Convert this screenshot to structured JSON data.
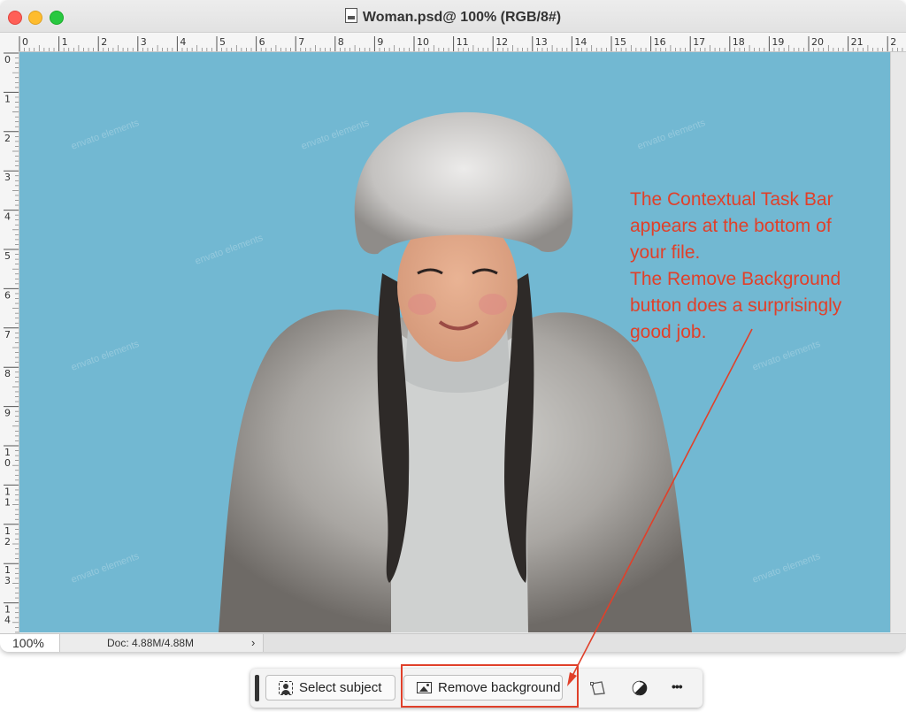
{
  "window": {
    "title": "Woman.psd@ 100% (RGB/8#)"
  },
  "ruler": {
    "horizontal": [
      "0",
      "1",
      "2",
      "3",
      "4",
      "5",
      "6",
      "7",
      "8",
      "9",
      "10",
      "11",
      "12",
      "13",
      "14",
      "15",
      "16",
      "17",
      "18",
      "19",
      "20",
      "21",
      "2"
    ],
    "vertical": [
      "0",
      "1",
      "2",
      "3",
      "4",
      "5",
      "6",
      "7",
      "8",
      "9",
      "1\n0",
      "1\n1",
      "1\n2",
      "1\n3",
      "1\n4"
    ]
  },
  "status": {
    "zoom": "100%",
    "doc": "Doc: 4.88M/4.88M",
    "arrow": "›"
  },
  "annotation": {
    "lines": [
      "The Contextual Task Bar",
      "appears at the bottom of",
      "your file.",
      "The Remove Background",
      "button does a surprisingly",
      "good job."
    ],
    "color": "#e0402a"
  },
  "taskbar": {
    "select_subject": "Select subject",
    "remove_background": "Remove background",
    "more": "•••"
  },
  "canvas": {
    "background_color": "#72b8d2",
    "watermark": "envato elements"
  }
}
